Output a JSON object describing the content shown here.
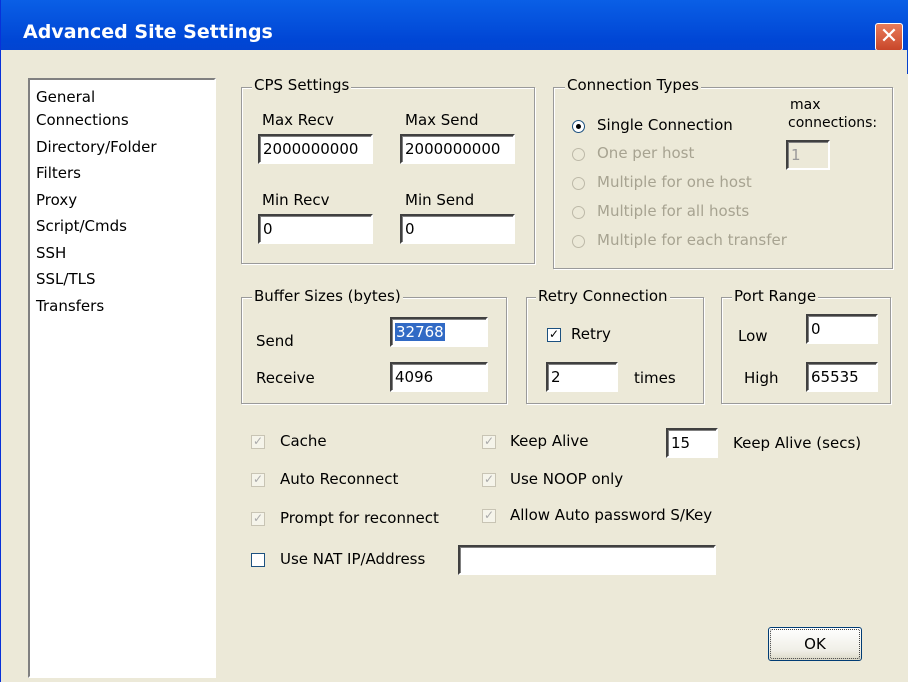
{
  "window": {
    "title": "Advanced Site Settings",
    "close_glyph": "✕"
  },
  "sidebar": {
    "items": [
      {
        "label": "General"
      },
      {
        "label": "Connections"
      },
      {
        "label": "Directory/Folder"
      },
      {
        "label": "Filters"
      },
      {
        "label": "Proxy"
      },
      {
        "label": "Script/Cmds"
      },
      {
        "label": "SSH"
      },
      {
        "label": "SSL/TLS"
      },
      {
        "label": "Transfers"
      }
    ]
  },
  "cps": {
    "legend": "CPS Settings",
    "max_recv_label": "Max Recv",
    "max_recv_value": "2000000000",
    "max_send_label": "Max Send",
    "max_send_value": "2000000000",
    "min_recv_label": "Min Recv",
    "min_recv_value": "0",
    "min_send_label": "Min Send",
    "min_send_value": "0"
  },
  "connection_types": {
    "legend": "Connection Types",
    "max_label_1": "max",
    "max_label_2": "connections:",
    "max_value": "1",
    "options": [
      {
        "label": "Single Connection",
        "selected": true,
        "enabled": true
      },
      {
        "label": "One per host",
        "selected": false,
        "enabled": false
      },
      {
        "label": "Multiple for one host",
        "selected": false,
        "enabled": false
      },
      {
        "label": "Multiple for all hosts",
        "selected": false,
        "enabled": false
      },
      {
        "label": "Multiple for each transfer",
        "selected": false,
        "enabled": false
      }
    ]
  },
  "buffer": {
    "legend": "Buffer Sizes (bytes)",
    "send_label": "Send",
    "send_value": "32768",
    "receive_label": "Receive",
    "receive_value": "4096"
  },
  "retry": {
    "legend": "Retry Connection",
    "retry_label": "Retry",
    "retry_checked": true,
    "times_value": "2",
    "times_label": "times"
  },
  "port_range": {
    "legend": "Port Range",
    "low_label": "Low",
    "low_value": "0",
    "high_label": "High",
    "high_value": "65535"
  },
  "options": {
    "cache": "Cache",
    "auto_reconnect": "Auto Reconnect",
    "prompt_reconnect": "Prompt for reconnect",
    "keep_alive": "Keep Alive",
    "use_noop": "Use NOOP only",
    "allow_auto_password": "Allow Auto password S/Key",
    "keep_alive_secs_value": "15",
    "keep_alive_secs_label": "Keep Alive (secs)",
    "use_nat_label": "Use NAT IP/Address",
    "use_nat_value": "",
    "check_glyph": "✓"
  },
  "buttons": {
    "ok": "OK"
  }
}
